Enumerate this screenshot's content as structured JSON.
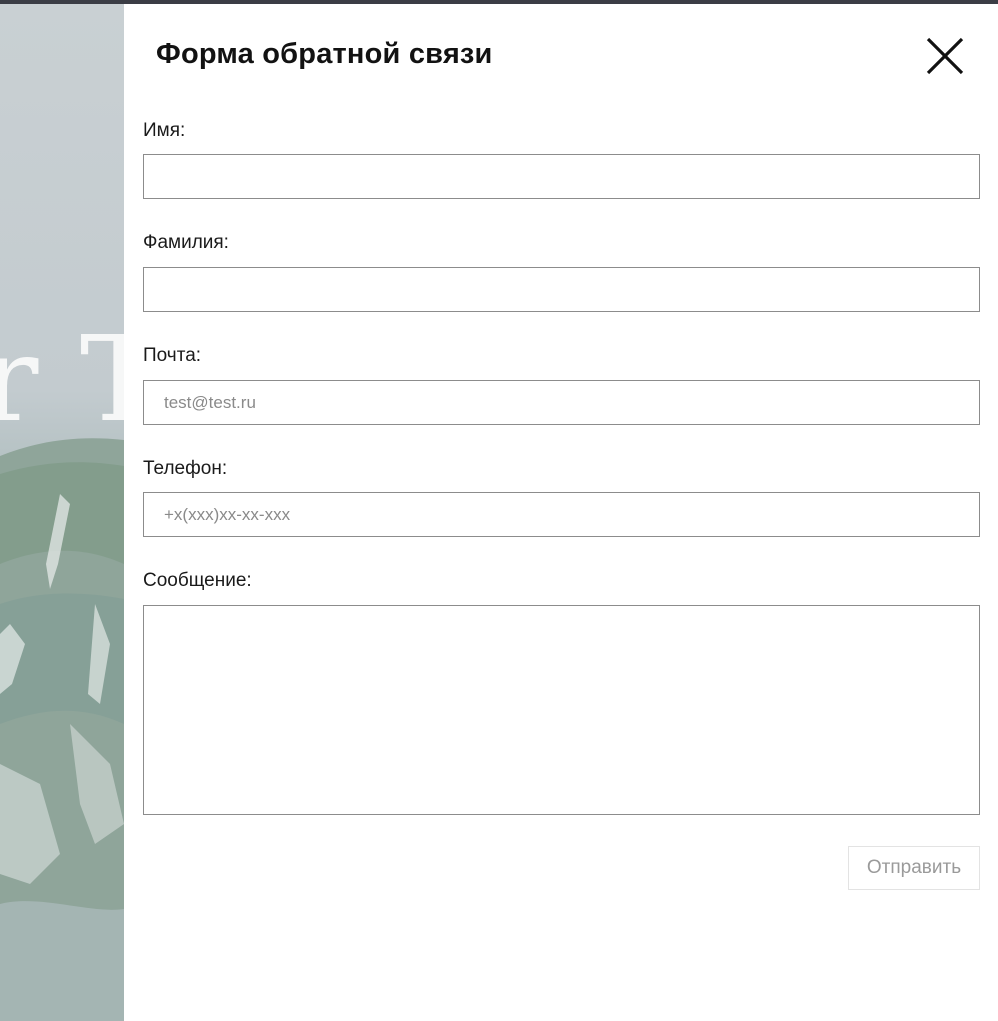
{
  "modal": {
    "title": "Форма обратной связи",
    "background_letters": "r T",
    "fields": {
      "first_name": {
        "label": "Имя:",
        "value": "",
        "placeholder": ""
      },
      "last_name": {
        "label": "Фамилия:",
        "value": "",
        "placeholder": ""
      },
      "email": {
        "label": "Почта:",
        "value": "",
        "placeholder": "test@test.ru"
      },
      "phone": {
        "label": "Телефон:",
        "value": "",
        "placeholder": "+x(xxx)xx-xx-xxx"
      },
      "message": {
        "label": "Сообщение:",
        "value": "",
        "placeholder": ""
      }
    },
    "submit_label": "Отправить"
  },
  "colors": {
    "topbar": "#3b3d45",
    "panel_bg": "#ffffff",
    "field_border": "#8c8c8c",
    "placeholder_text": "#8a8a8a",
    "submit_text_disabled": "#9a9a9a"
  },
  "icons": {
    "close": "close-icon"
  }
}
